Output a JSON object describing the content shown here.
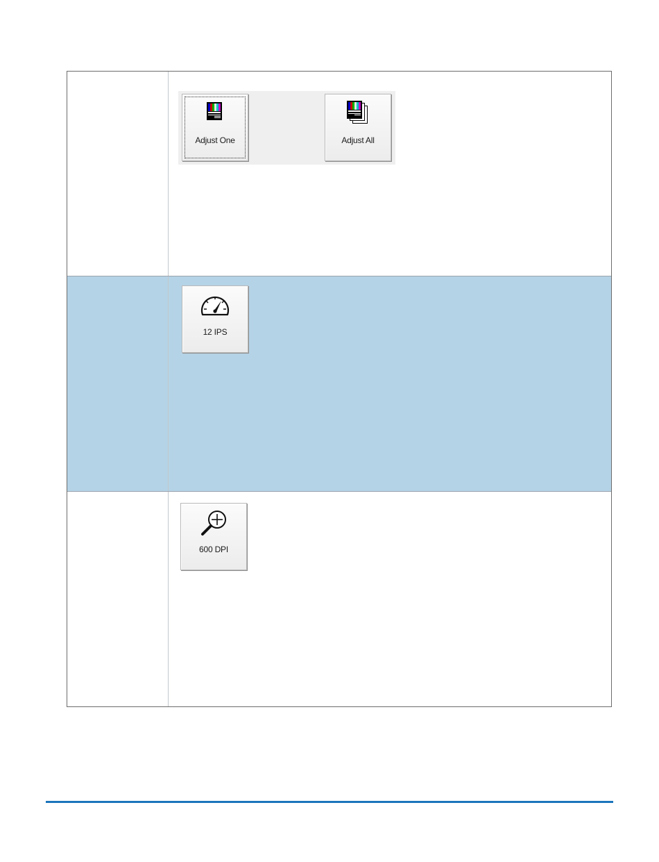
{
  "rows": [
    {
      "buttons": [
        {
          "label": "Adjust One",
          "icon": "color-bars-icon"
        },
        {
          "label": "Adjust All",
          "icon": "color-bars-stack-icon"
        }
      ]
    },
    {
      "buttons": [
        {
          "label": "12 IPS",
          "icon": "speedometer-icon"
        }
      ]
    },
    {
      "buttons": [
        {
          "label": "600 DPI",
          "icon": "zoom-in-icon"
        }
      ]
    }
  ],
  "colors": {
    "highlight_row": "#b5d3e6",
    "footer_rule": "#1b75bb",
    "table_border": "#6b6b6b"
  }
}
